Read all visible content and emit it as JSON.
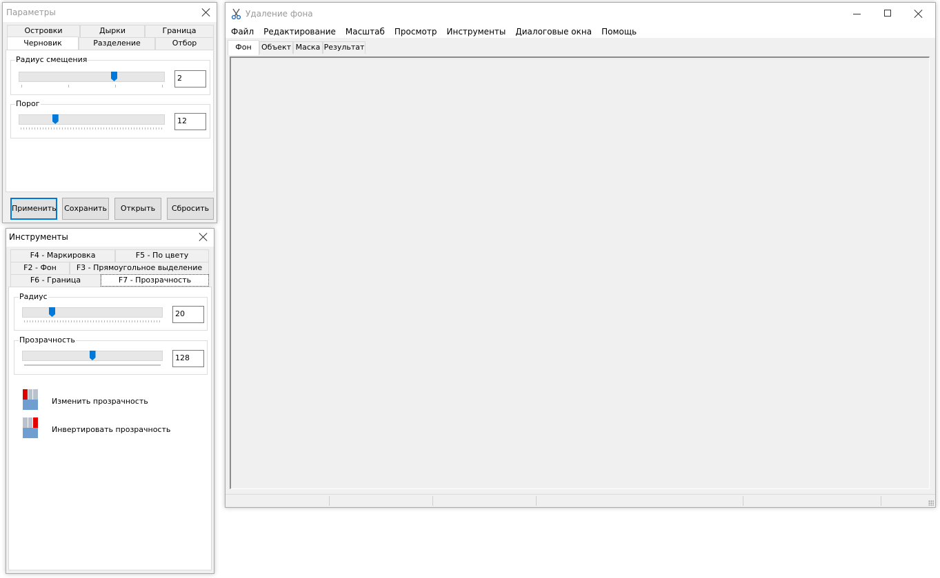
{
  "params_window": {
    "title": "Параметры",
    "tabs_row1": [
      "Островки",
      "Дырки",
      "Граница"
    ],
    "tabs_row2": [
      "Черновик",
      "Разделение",
      "Отбор"
    ],
    "active_tab": "Черновик",
    "offset_group": {
      "label": "Радиус смещения",
      "value": "2",
      "slider_fraction": 0.66
    },
    "threshold_group": {
      "label": "Порог",
      "value": "12",
      "slider_fraction": 0.24
    },
    "buttons": {
      "apply": "Применить",
      "save": "Сохранить",
      "open": "Открыть",
      "reset": "Сбросить"
    }
  },
  "tools_window": {
    "title": "Инструменты",
    "tabs_row1": [
      "F4 - Маркировка",
      "F5 - По цвету"
    ],
    "tabs_row2": [
      "F2 - Фон",
      "F3 - Прямоугольное выделение"
    ],
    "tabs_row3": [
      "F6 - Граница",
      "F7 - Прозрачность"
    ],
    "active_tab": "F7 - Прозрачность",
    "radius_group": {
      "label": "Радиус",
      "value": "20",
      "slider_fraction": 0.2
    },
    "transparency_group": {
      "label": "Прозрачность",
      "value": "128",
      "slider_fraction": 0.5
    },
    "actions": {
      "change": "Изменить прозрачность",
      "invert": "Инвертировать прозрачность"
    },
    "colors": {
      "accent": "#0078d7",
      "red": "#e00000",
      "blue": "#6e9fd0",
      "gray": "#b9c2cc"
    }
  },
  "main_window": {
    "title": "Удаление фона",
    "menu": [
      "Файл",
      "Редактирование",
      "Масштаб",
      "Просмотр",
      "Инструменты",
      "Диалоговые окна",
      "Помощь"
    ],
    "tabs": [
      "Фон",
      "Объект",
      "Маска",
      "Результат"
    ],
    "active_tab": "Фон",
    "app_icon": "scissors-icon"
  }
}
